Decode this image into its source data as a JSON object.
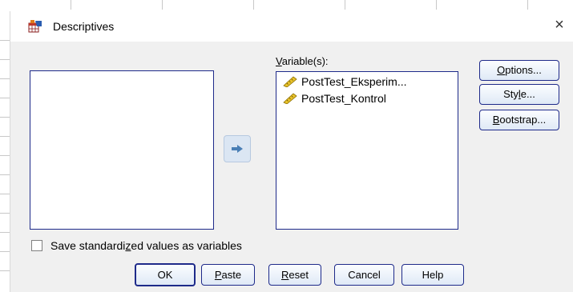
{
  "window": {
    "title": "Descriptives",
    "close_glyph": "×"
  },
  "variables": {
    "label_underlined": "V",
    "label_rest": "ariable(s):",
    "items": [
      {
        "name": "PostTest_Eksperim...",
        "icon": "scale-ruler-icon"
      },
      {
        "name": "PostTest_Kontrol",
        "icon": "scale-ruler-icon"
      }
    ]
  },
  "side_buttons": {
    "options": {
      "ul": "O",
      "rest": "ptions..."
    },
    "style": {
      "pre": "Sty",
      "ul": "l",
      "rest": "e..."
    },
    "bootstrap": {
      "ul": "B",
      "rest": "ootstrap..."
    }
  },
  "checkbox": {
    "pre": "Save standardi",
    "ul": "z",
    "rest": "ed values as variables",
    "checked": false
  },
  "bottom_buttons": {
    "ok": "OK",
    "paste": {
      "ul": "P",
      "rest": "aste"
    },
    "reset": {
      "ul": "R",
      "rest": "eset"
    },
    "cancel": "Cancel",
    "help": "Help"
  },
  "colors": {
    "accent_border": "#1e2a8a",
    "dialog_bg": "#f0f0f0",
    "arrow_fill": "#4a7fb5"
  }
}
